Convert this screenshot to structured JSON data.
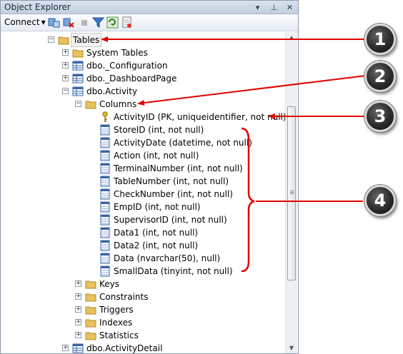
{
  "panel": {
    "title": "Object Explorer",
    "titlebar_buttons": {
      "dropdown": "▾",
      "pin": "⊥",
      "close": "✕"
    }
  },
  "toolbar": {
    "connect_label": "Connect",
    "icons": [
      "connect-icon",
      "disconnect-icon",
      "stop-icon",
      "filter-icon",
      "refresh-icon",
      "script-icon"
    ]
  },
  "tree": {
    "tables": "Tables",
    "system_tables": "System Tables",
    "t_configuration": "dbo._Configuration",
    "t_dashboardpage": "dbo._DashboardPage",
    "t_activity": "dbo.Activity",
    "columns": "Columns",
    "col_activityid": "ActivityID (PK, uniqueidentifier, not null)",
    "col_storeid": "StoreID (int, not null)",
    "col_activitydate": "ActivityDate (datetime, not null)",
    "col_action": "Action (int, not null)",
    "col_terminalnumber": "TerminalNumber (int, not null)",
    "col_tablenumber": "TableNumber (int, not null)",
    "col_checknumber": "CheckNumber (int, not null)",
    "col_empid": "EmpID (int, not null)",
    "col_supervisorid": "SupervisorID (int, not null)",
    "col_data1": "Data1 (int, not null)",
    "col_data2": "Data2 (int, not null)",
    "col_data": "Data (nvarchar(50), null)",
    "col_smalldata": "SmallData (tinyint, not null)",
    "keys": "Keys",
    "constraints": "Constraints",
    "triggers": "Triggers",
    "indexes": "Indexes",
    "statistics": "Statistics",
    "t_activitydetail": "dbo.ActivityDetail"
  },
  "callouts": {
    "c1": "1",
    "c2": "2",
    "c3": "3",
    "c4": "4"
  },
  "colors": {
    "arrow_red": "#e00000",
    "folder": "#e8c25a",
    "table_blue": "#3a63a8"
  }
}
